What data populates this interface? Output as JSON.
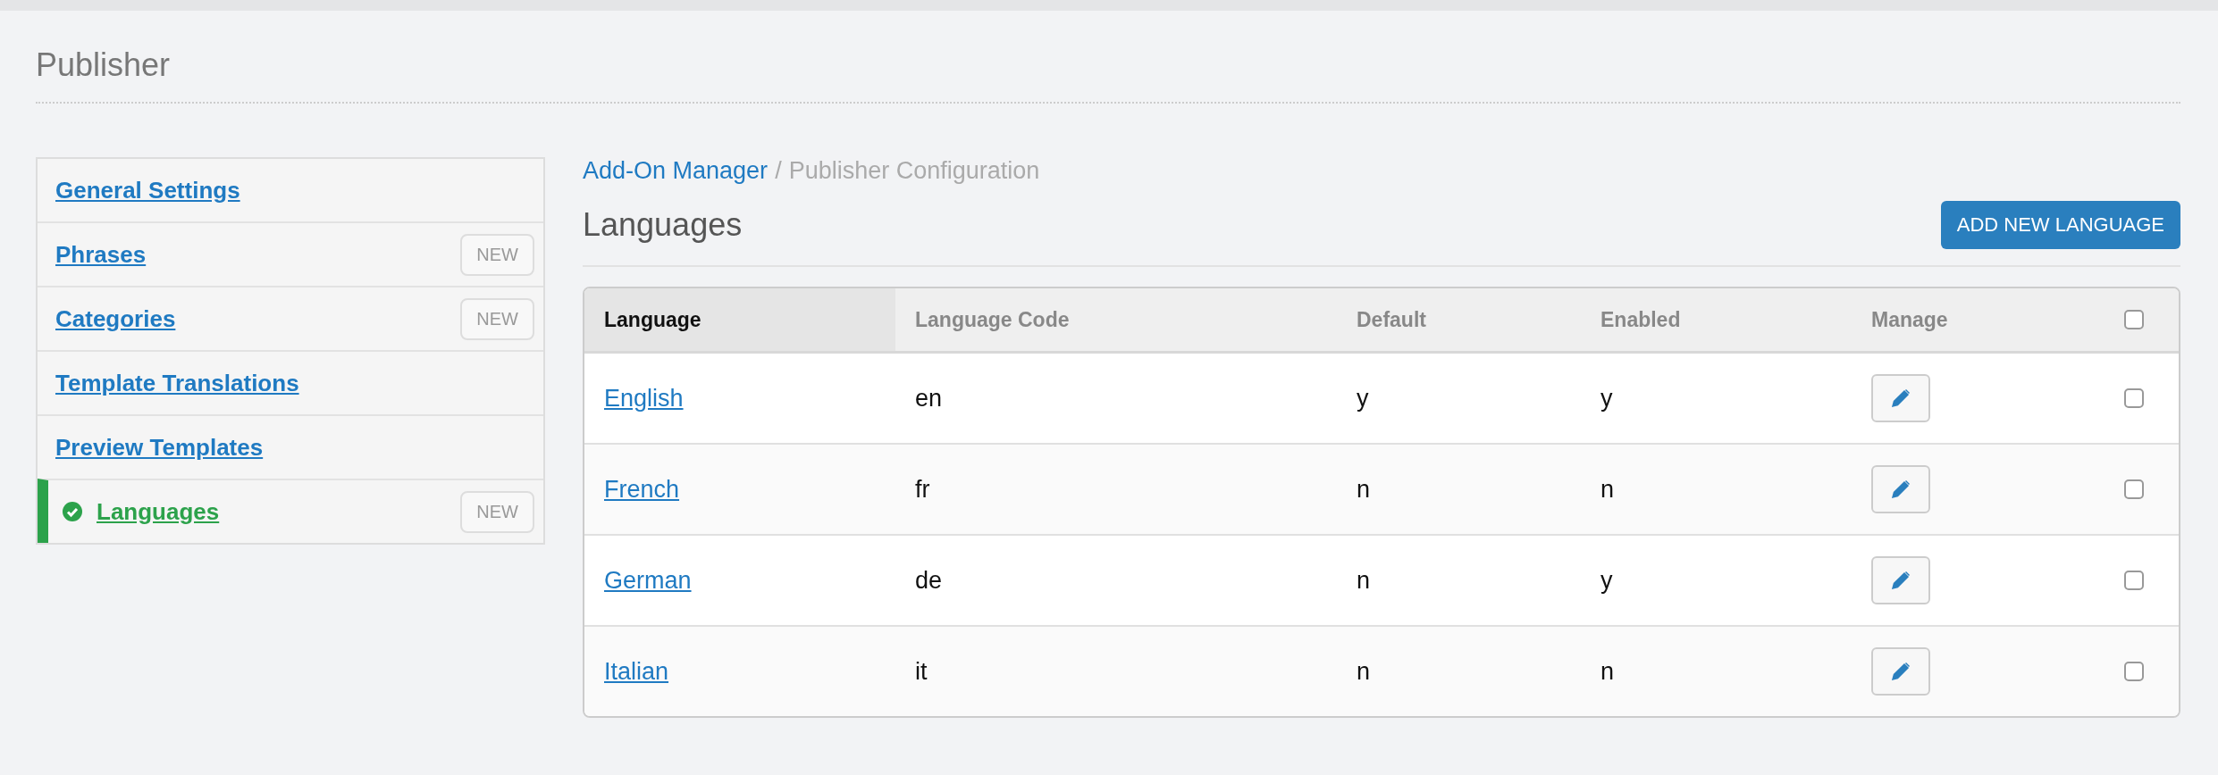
{
  "page_title": "Publisher",
  "sidebar": {
    "items": [
      {
        "label": "General Settings",
        "selected": false
      },
      {
        "label": "Phrases",
        "selected": false,
        "badge": "NEW"
      },
      {
        "label": "Categories",
        "selected": false,
        "badge": "NEW"
      },
      {
        "label": "Template Translations",
        "selected": false
      },
      {
        "label": "Preview Templates",
        "selected": false
      },
      {
        "label": "Languages",
        "selected": true,
        "badge": "NEW"
      }
    ]
  },
  "breadcrumb": {
    "link": "Add-On Manager",
    "separator": "/",
    "current": "Publisher Configuration"
  },
  "heading": "Languages",
  "add_button": "ADD NEW LANGUAGE",
  "table": {
    "columns": [
      {
        "label": "Language",
        "sorted": true
      },
      {
        "label": "Language Code",
        "sorted": false
      },
      {
        "label": "Default",
        "sorted": false
      },
      {
        "label": "Enabled",
        "sorted": false
      },
      {
        "label": "Manage",
        "sorted": false
      }
    ],
    "header_checked": false,
    "rows": [
      {
        "language": "English",
        "code": "en",
        "default": "y",
        "enabled": "y",
        "checked": false
      },
      {
        "language": "French",
        "code": "fr",
        "default": "n",
        "enabled": "n",
        "checked": false
      },
      {
        "language": "German",
        "code": "de",
        "default": "n",
        "enabled": "y",
        "checked": false
      },
      {
        "language": "Italian",
        "code": "it",
        "default": "n",
        "enabled": "n",
        "checked": false
      }
    ]
  }
}
